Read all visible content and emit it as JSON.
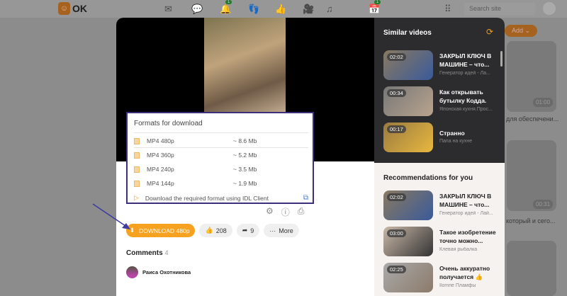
{
  "topbar": {
    "logo": "OK",
    "search_placeholder": "Search site",
    "badges": [
      "1",
      "1"
    ]
  },
  "background": {
    "add_label": "Add",
    "durations": [
      "01:00",
      "00:31"
    ],
    "titles": [
      "для обеспечени...",
      "который и сего..."
    ]
  },
  "similar": {
    "title": "Similar videos",
    "items": [
      {
        "duration": "02:02",
        "title": "ЗАКРЫЛ КЛЮЧ В МАШИНЕ – что...",
        "source": "Генератор идей - Ла..."
      },
      {
        "duration": "00:34",
        "title": "Как открывать бутылку Кодда.",
        "source": "Японская кухня.Прос..."
      },
      {
        "duration": "00:17",
        "title": "Странно",
        "source": "Папа на кухне"
      }
    ]
  },
  "recommendations": {
    "title": "Recommendations for you",
    "items": [
      {
        "duration": "02:02",
        "title": "ЗАКРЫЛ КЛЮЧ В МАШИНЕ – что...",
        "source": "Генератор идей - Лай..."
      },
      {
        "duration": "03:00",
        "title": "Такое изобретение точно можно...",
        "source": "Клевая рыбалка"
      },
      {
        "duration": "02:25",
        "title": "Очень аккуратно получается 👍",
        "source": "Ilоmпе Пламфы"
      }
    ]
  },
  "download_popup": {
    "title": "Formats for download",
    "formats": [
      {
        "name": "MP4 480p",
        "size": "~ 8.6 Mb"
      },
      {
        "name": "MP4 360p",
        "size": "~ 5.2 Mb"
      },
      {
        "name": "MP4 240p",
        "size": "~ 3.5 Mb"
      },
      {
        "name": "MP4 144p",
        "size": "~ 1.9 Mb"
      }
    ],
    "idl_text": "Download the required format using IDL Client"
  },
  "actions": {
    "download": "DOWNLOAD 480p",
    "likes": "208",
    "shares": "9",
    "more": "More"
  },
  "comments": {
    "label": "Comments",
    "count": "4",
    "first_user": "Раиса Охотникова"
  },
  "colors": {
    "accent": "#f6a11f",
    "popup_border": "#3d2f7a"
  }
}
